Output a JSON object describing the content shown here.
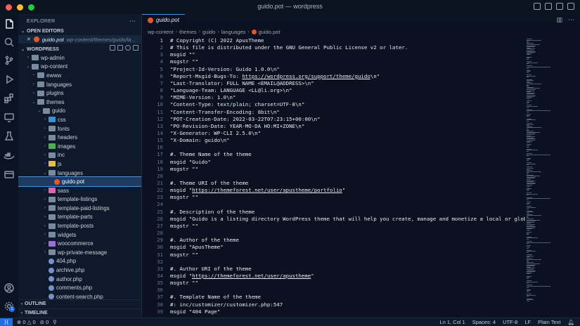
{
  "window": {
    "title": "guido.pot — wordpress"
  },
  "sidebar": {
    "header": "EXPLORER",
    "open_editors": {
      "label": "OPEN EDITORS",
      "file": "guido.pot",
      "path": "wp-content/themes/guido/la..."
    },
    "workspace": "WORDPRESS",
    "outline": "OUTLINE",
    "timeline": "TIMELINE",
    "tree": [
      {
        "label": "wp-admin",
        "depth": 0,
        "chev": "›",
        "kind": "folder"
      },
      {
        "label": "wp-content",
        "depth": 0,
        "chev": "⌄",
        "kind": "folder"
      },
      {
        "label": "ewww",
        "depth": 1,
        "chev": "›",
        "kind": "folder"
      },
      {
        "label": "languages",
        "depth": 1,
        "chev": "›",
        "kind": "folder"
      },
      {
        "label": "plugins",
        "depth": 1,
        "chev": "›",
        "kind": "folder"
      },
      {
        "label": "themes",
        "depth": 1,
        "chev": "⌄",
        "kind": "folder"
      },
      {
        "label": "guido",
        "depth": 2,
        "chev": "⌄",
        "kind": "folder"
      },
      {
        "label": "css",
        "depth": 3,
        "chev": "›",
        "kind": "folder-blue"
      },
      {
        "label": "fonts",
        "depth": 3,
        "chev": "›",
        "kind": "folder"
      },
      {
        "label": "headers",
        "depth": 3,
        "chev": "›",
        "kind": "folder"
      },
      {
        "label": "images",
        "depth": 3,
        "chev": "›",
        "kind": "folder-green"
      },
      {
        "label": "inc",
        "depth": 3,
        "chev": "›",
        "kind": "folder"
      },
      {
        "label": "js",
        "depth": 3,
        "chev": "›",
        "kind": "folder-yellow"
      },
      {
        "label": "languages",
        "depth": 3,
        "chev": "⌄",
        "kind": "folder"
      },
      {
        "label": "guido.pot",
        "depth": 4,
        "chev": "",
        "kind": "file-pot",
        "selected": true
      },
      {
        "label": "sass",
        "depth": 3,
        "chev": "›",
        "kind": "folder-pink"
      },
      {
        "label": "template-listings",
        "depth": 3,
        "chev": "›",
        "kind": "folder"
      },
      {
        "label": "template-paid-listings",
        "depth": 3,
        "chev": "›",
        "kind": "folder"
      },
      {
        "label": "template-parts",
        "depth": 3,
        "chev": "›",
        "kind": "folder"
      },
      {
        "label": "template-posts",
        "depth": 3,
        "chev": "›",
        "kind": "folder"
      },
      {
        "label": "widgets",
        "depth": 3,
        "chev": "›",
        "kind": "folder"
      },
      {
        "label": "woocommerce",
        "depth": 3,
        "chev": "›",
        "kind": "folder-purple"
      },
      {
        "label": "wp-private-message",
        "depth": 3,
        "chev": "›",
        "kind": "folder"
      },
      {
        "label": "404.php",
        "depth": 3,
        "chev": "",
        "kind": "file-php"
      },
      {
        "label": "archive.php",
        "depth": 3,
        "chev": "",
        "kind": "file-php"
      },
      {
        "label": "author.php",
        "depth": 3,
        "chev": "",
        "kind": "file-php"
      },
      {
        "label": "comments.php",
        "depth": 3,
        "chev": "",
        "kind": "file-php"
      },
      {
        "label": "content-search.php",
        "depth": 3,
        "chev": "",
        "kind": "file-php"
      }
    ]
  },
  "editor": {
    "tab": "guido.pot",
    "breadcrumb": [
      "wp-content",
      "themes",
      "guido",
      "languages",
      "guido.pot"
    ],
    "lines": [
      {
        "n": "1",
        "t": "# Copyright (C) 2022 ApusTheme"
      },
      {
        "n": "2",
        "t": "# This file is distributed under the GNU General Public License v2 or later."
      },
      {
        "n": "3",
        "t": "msgid \"\""
      },
      {
        "n": "4",
        "t": "msgstr \"\""
      },
      {
        "n": "5",
        "t": "\"Project-Id-Version: Guido 1.0.0\\n\""
      },
      {
        "n": "6",
        "t": "\"Report-Msgid-Bugs-To: ",
        "u": "https://wordpress.org/support/theme/guido",
        "a": "\\n\""
      },
      {
        "n": "7",
        "t": "\"Last-Translator: FULL NAME <EMAIL@ADDRESS>\\n\""
      },
      {
        "n": "8",
        "t": "\"Language-Team: LANGUAGE <LL@li.org>\\n\""
      },
      {
        "n": "9",
        "t": "\"MIME-Version: 1.0\\n\""
      },
      {
        "n": "10",
        "t": "\"Content-Type: text/plain; charset=UTF-8\\n\""
      },
      {
        "n": "11",
        "t": "\"Content-Transfer-Encoding: 8bit\\n\""
      },
      {
        "n": "12",
        "t": "\"POT-Creation-Date: 2022-03-22T07:23:15+00:00\\n\""
      },
      {
        "n": "13",
        "t": "\"PO-Revision-Date: YEAR-MO-DA HO:MI+ZONE\\n\""
      },
      {
        "n": "14",
        "t": "\"X-Generator: WP-CLI 2.5.0\\n\""
      },
      {
        "n": "15",
        "t": "\"X-Domain: guido\\n\""
      },
      {
        "n": "16",
        "t": ""
      },
      {
        "n": "17",
        "t": "#. Theme Name of the theme"
      },
      {
        "n": "18",
        "t": "msgid \"Guido\""
      },
      {
        "n": "19",
        "t": "msgstr \"\""
      },
      {
        "n": "20",
        "t": ""
      },
      {
        "n": "21",
        "t": "#. Theme URI of the theme"
      },
      {
        "n": "22",
        "t": "msgid \"",
        "u": "https://themeforest.net/user/apustheme/portfolio",
        "a": "\""
      },
      {
        "n": "23",
        "t": "msgstr \"\""
      },
      {
        "n": "24",
        "t": ""
      },
      {
        "n": "25",
        "t": "#. Description of the theme"
      },
      {
        "n": "26",
        "t": "msgid \"Guido is a listing directory WordPress theme that will help you create, manage and monetize a local or global direc"
      },
      {
        "n": "27",
        "t": "msgstr \"\""
      },
      {
        "n": "28",
        "t": ""
      },
      {
        "n": "29",
        "t": "#. Author of the theme"
      },
      {
        "n": "30",
        "t": "msgid \"ApusTheme\""
      },
      {
        "n": "31",
        "t": "msgstr \"\""
      },
      {
        "n": "32",
        "t": ""
      },
      {
        "n": "33",
        "t": "#. Author URI of the theme"
      },
      {
        "n": "34",
        "t": "msgid \"",
        "u": "https://themeforest.net/user/apustheme",
        "a": "\""
      },
      {
        "n": "35",
        "t": "msgstr \"\""
      },
      {
        "n": "36",
        "t": ""
      },
      {
        "n": "37",
        "t": "#. Template Name of the theme"
      },
      {
        "n": "38",
        "t": "#: inc/customizer/customizer.php:547"
      },
      {
        "n": "39",
        "t": "msgid \"404 Page\""
      }
    ]
  },
  "status": {
    "remote": "⟩⟨",
    "errors": "0",
    "warnings": "0",
    "ports": "0",
    "position": "Ln 1, Col 1",
    "spaces": "Spaces: 4",
    "encoding": "UTF-8",
    "eol": "LF",
    "language": "Plain Text"
  },
  "colors": {
    "accent": "#4b8fd6",
    "background": "#0b1120",
    "sidebar": "#0e1a2c"
  }
}
